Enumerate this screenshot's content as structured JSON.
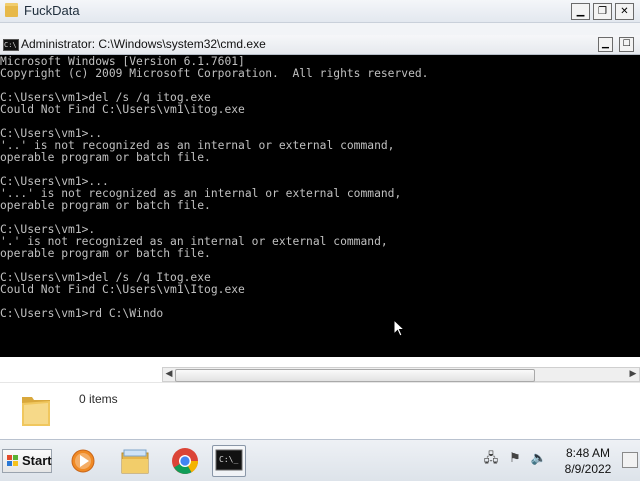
{
  "explorer": {
    "title": "FuckData",
    "controls": {
      "minimize": "▁",
      "restore": "❐",
      "close": "✕"
    },
    "status": "0 items"
  },
  "cmd": {
    "title": "Administrator: C:\\Windows\\system32\\cmd.exe",
    "icon_text": "C:\\",
    "controls": {
      "minimize": "▁",
      "maximize": "☐"
    },
    "lines": [
      "Microsoft Windows [Version 6.1.7601]",
      "Copyright (c) 2009 Microsoft Corporation.  All rights reserved.",
      "",
      "C:\\Users\\vm1>del /s /q itog.exe",
      "Could Not Find C:\\Users\\vm1\\itog.exe",
      "",
      "C:\\Users\\vm1>..",
      "'..' is not recognized as an internal or external command,",
      "operable program or batch file.",
      "",
      "C:\\Users\\vm1>...",
      "'...' is not recognized as an internal or external command,",
      "operable program or batch file.",
      "",
      "C:\\Users\\vm1>.",
      "'.' is not recognized as an internal or external command,",
      "operable program or batch file.",
      "",
      "C:\\Users\\vm1>del /s /q Itog.exe",
      "Could Not Find C:\\Users\\vm1\\Itog.exe",
      "",
      "C:\\Users\\vm1>rd C:\\Windo"
    ]
  },
  "scrollbar": {
    "left_arrow": "◀",
    "right_arrow": "▶"
  },
  "taskbar": {
    "start_label": "Start",
    "clock_time": "8:48 AM",
    "clock_date": "8/9/2022",
    "apps": [
      "media-player-icon",
      "explorer-icon",
      "chrome-icon",
      "cmd-icon"
    ],
    "tray": [
      "network-icon",
      "action-center-icon",
      "volume-icon"
    ]
  },
  "colors": {
    "console_bg": "#000000",
    "console_fg": "#c0c0c0"
  }
}
